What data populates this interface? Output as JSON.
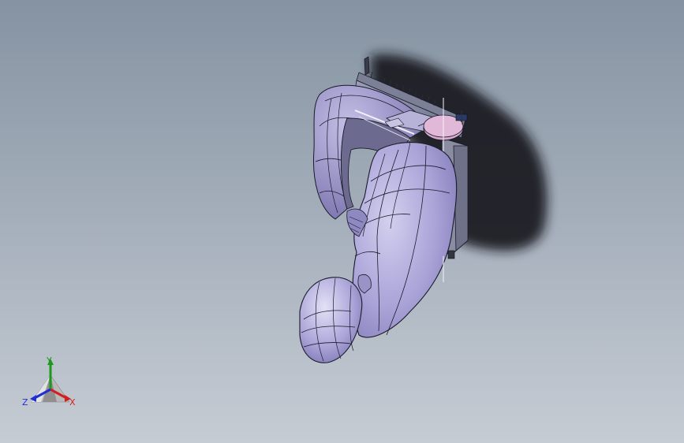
{
  "viewport": {
    "background_top": "#8593a2",
    "background_bottom": "#c6ccd4"
  },
  "model": {
    "icon": "3d-part-model-icon",
    "body_color": "#a9a4d6",
    "edge_color": "#1a1a2a",
    "shadow_color": "#1c1c22",
    "disc_color": "#d7a9cc"
  },
  "triad": {
    "icon": "coordinate-triad-icon",
    "x_label": "X",
    "y_label": "Y",
    "z_label": "Z",
    "x_color": "#d22020",
    "y_color": "#1a9a1a",
    "z_color": "#2030d0"
  }
}
